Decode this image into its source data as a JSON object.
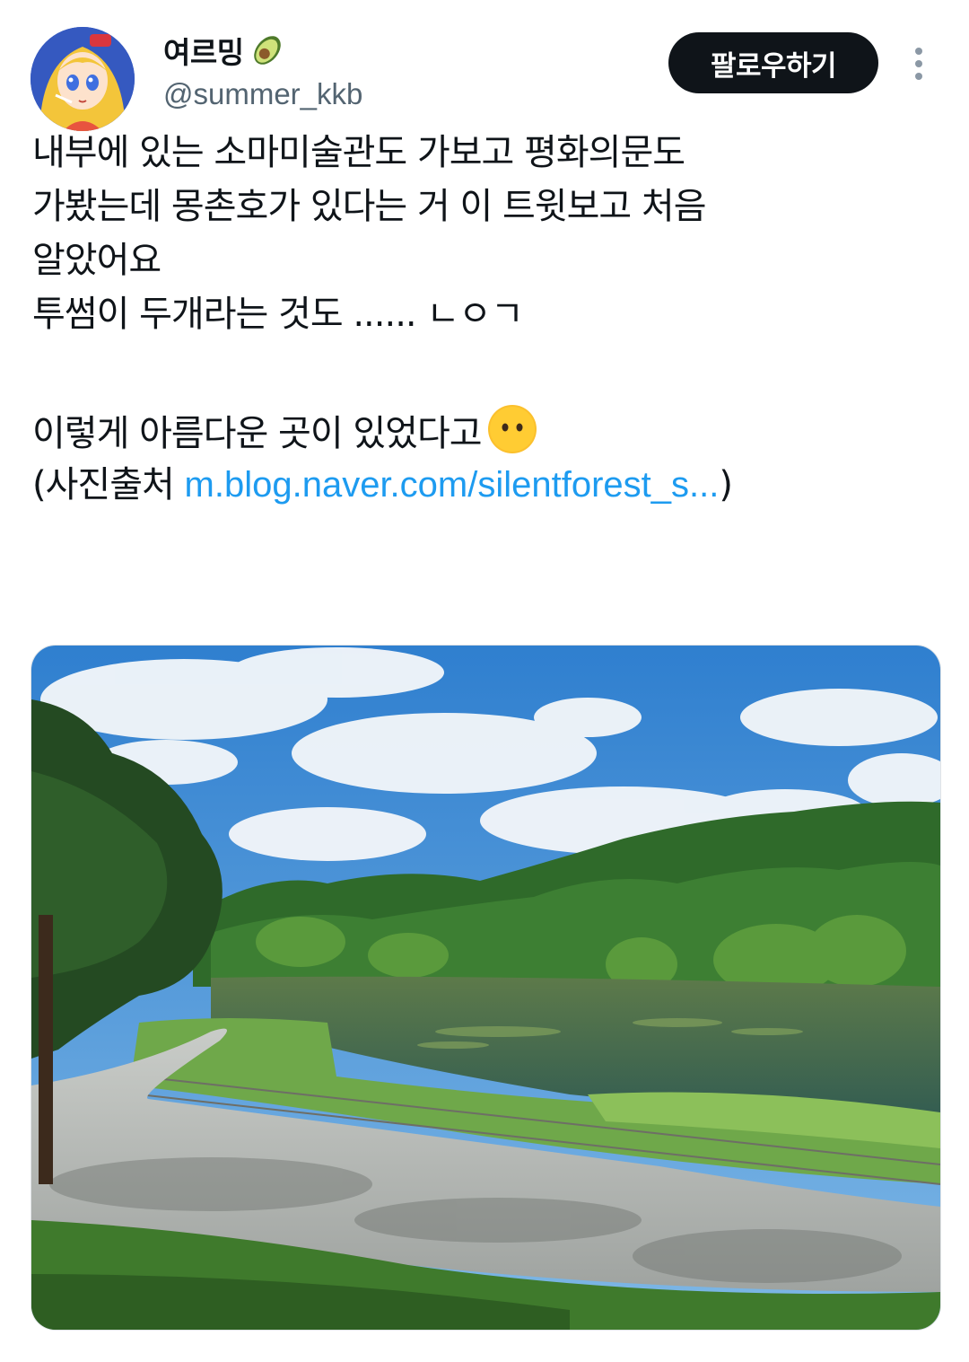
{
  "author": {
    "display_name": "여르밍",
    "display_emoji_icon": "avocado-emoji",
    "handle": "@summer_kkb"
  },
  "actions": {
    "follow_label": "팔로우하기",
    "more_icon": "more-vertical-icon"
  },
  "tweet": {
    "lines": [
      "내부에 있는 소마미술관도 가보고 평화의문도",
      "가봤는데 몽촌호가 있다는 거 이 트윗보고 처음",
      "알았어요",
      "투썸이 두개라는 것도 ...... ㄴㅇㄱ"
    ],
    "line5": "이렇게 아름다운 곳이 있었다고",
    "line5_emoji_icon": "no-mouth-face-emoji",
    "source_prefix": "(사진출처 ",
    "source_link": "m.blog.naver.com/silentforest_s...",
    "source_suffix": ")"
  },
  "colors": {
    "link": "#1d9bf0",
    "handle": "#536471",
    "button_bg": "#0f1419"
  }
}
